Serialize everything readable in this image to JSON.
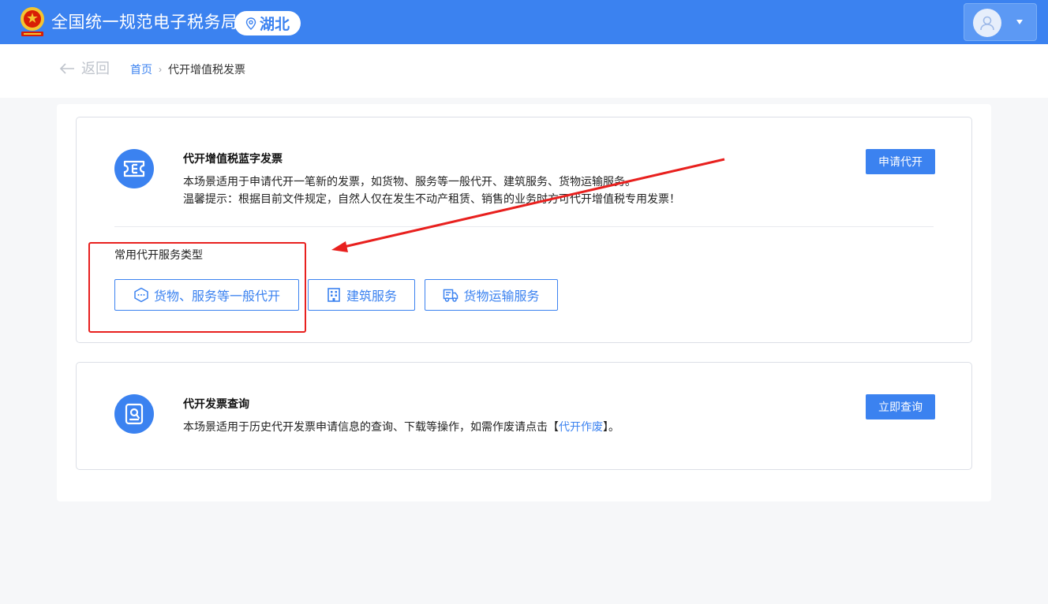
{
  "header": {
    "site_title": "全国统一规范电子税务局",
    "region": "湖北",
    "emblem_icon": "national-emblem-icon",
    "user_icon": "user-avatar-icon"
  },
  "nav": {
    "back_label": "返回",
    "breadcrumb": {
      "home": "首页",
      "separator": "›",
      "current": "代开增值税发票"
    }
  },
  "cards": {
    "issue": {
      "title": "代开增值税蓝字发票",
      "desc_line1": "本场景适用于申请代开一笔新的发票，如货物、服务等一般代开、建筑服务、货物运输服务。",
      "desc_line2": "温馨提示：根据目前文件规定，自然人仅在发生不动产租赁、销售的业务时方可代开增值税专用发票！",
      "button": "申请代开",
      "section_label": "常用代开服务类型",
      "service_types": [
        {
          "label": "货物、服务等一般代开",
          "icon": "goods-box-icon"
        },
        {
          "label": "建筑服务",
          "icon": "building-icon"
        },
        {
          "label": "货物运输服务",
          "icon": "truck-icon"
        }
      ]
    },
    "query": {
      "title": "代开发票查询",
      "desc_prefix": "本场景适用于历史代开发票申请信息的查询、下载等操作，如需作废请点击【",
      "desc_link": "代开作废",
      "desc_suffix": "】。",
      "button": "立即查询"
    }
  },
  "colors": {
    "primary": "#3b82f0",
    "annotation": "#e8201e"
  }
}
